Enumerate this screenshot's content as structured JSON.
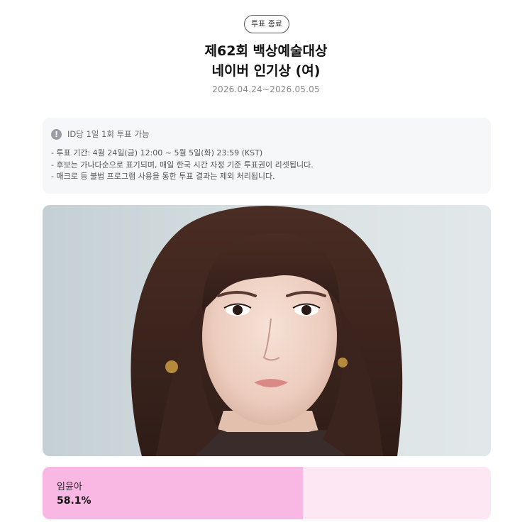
{
  "badge": "투표 종료",
  "title_line1": "제62회 백상예술대상",
  "title_line2": "네이버 인기상 (여)",
  "period": "2026.04.24~2026.05.05",
  "notice": {
    "icon": "info-icon",
    "title": "ID당 1일 1회 투표 가능",
    "lines": [
      "- 투표 기간: 4월 24일(금) 12:00 ~ 5월 5일(화) 23:59 (KST)",
      "- 후보는 가나다순으로 표기되며, 매일 한국 시간 자정 기준 투표권이 리셋됩니다.",
      "- 매크로 등 불법 프로그램 사용을 통한 투표 결과는 제외 처리됩니다."
    ]
  },
  "candidate": {
    "name": "임윤아",
    "percent_text": "58.1%",
    "percent_value": 58.1,
    "bar_color": "#f9b8e3",
    "track_color": "#fde7f3"
  }
}
